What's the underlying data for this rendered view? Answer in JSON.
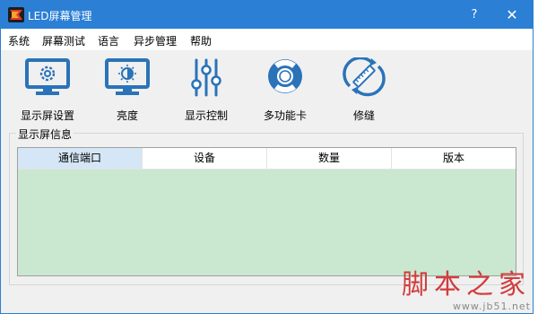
{
  "window": {
    "title": "LED屏幕管理"
  },
  "titlebar": {
    "help": "?",
    "close": "✕"
  },
  "menu": [
    "系统",
    "屏幕测试",
    "语言",
    "异步管理",
    "帮助"
  ],
  "toolbar": [
    {
      "label": "显示屏设置",
      "icon": "monitor-gear-icon"
    },
    {
      "label": "亮度",
      "icon": "brightness-icon"
    },
    {
      "label": "显示控制",
      "icon": "sliders-icon"
    },
    {
      "label": "多功能卡",
      "icon": "lifebuoy-icon"
    },
    {
      "label": "修缝",
      "icon": "seam-repair-icon"
    }
  ],
  "panel": {
    "title": "显示屏信息",
    "columns": [
      "通信端口",
      "设备",
      "数量",
      "版本"
    ],
    "selected_column": "通信端口",
    "rows": []
  },
  "watermark": {
    "text": "脚本之家",
    "url": "www.jb51.net"
  },
  "colors": {
    "titlebar": "#2b7fd4",
    "icon_blue": "#2a73b9",
    "grid_bg": "#cae8cf",
    "selected_header": "#d5e6f6"
  }
}
